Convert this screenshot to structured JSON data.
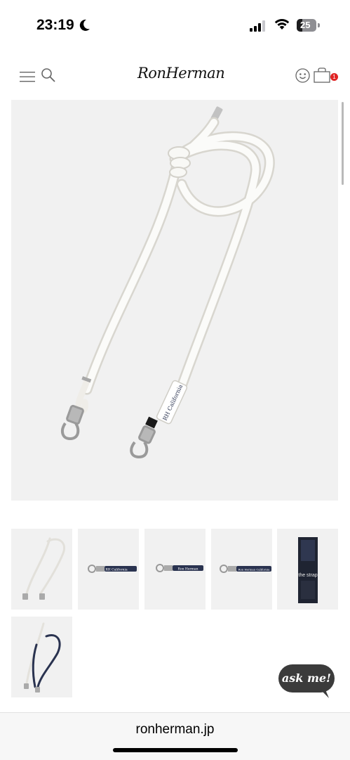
{
  "status_bar": {
    "time": "23:19",
    "battery": "25"
  },
  "header": {
    "logo": "RonHerman",
    "cart_count": "1"
  },
  "product": {
    "main_image_alt": "White rope strap with clip hooks",
    "strap_label": "RH California",
    "thumbnails": [
      {
        "name": "white-rope-strap"
      },
      {
        "name": "navy-strap-rh-california",
        "label": "RH California"
      },
      {
        "name": "navy-strap-ron-herman",
        "label": "Ron Herman"
      },
      {
        "name": "navy-strap-long",
        "label": "Ron Herman California"
      },
      {
        "name": "strap-package",
        "label": "the strap"
      },
      {
        "name": "white-and-navy-straps"
      }
    ]
  },
  "chat": {
    "label": "ask me!"
  },
  "browser": {
    "url": "ronherman.jp"
  },
  "colors": {
    "navy": "#2a3350",
    "badge": "#e02424",
    "chat_bubble": "#3b3b3b"
  }
}
